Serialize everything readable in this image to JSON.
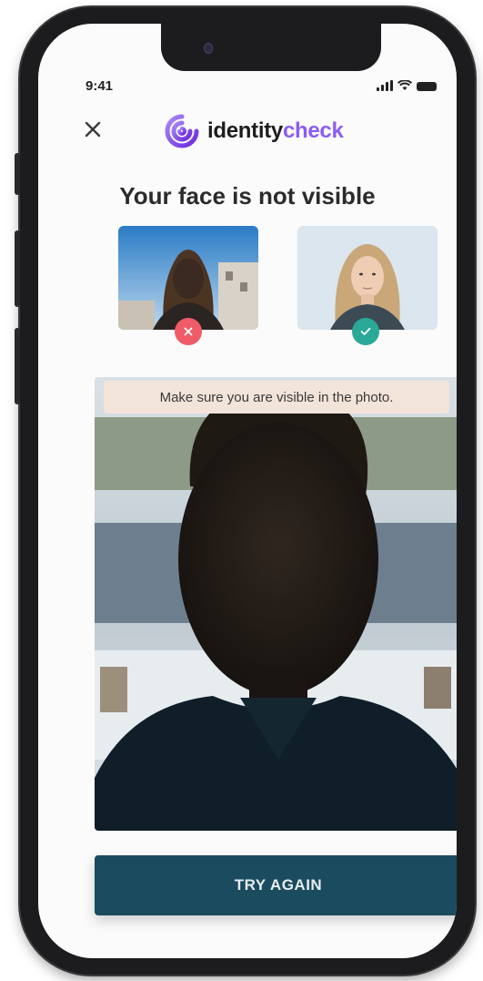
{
  "status_bar": {
    "time": "9:41"
  },
  "header": {
    "logo_part1": "identity",
    "logo_part2": "check",
    "brand_color": "#8b5cf6",
    "close_icon": "close-icon"
  },
  "headline": "Your face is not visible",
  "examples": [
    {
      "type": "bad",
      "status_icon": "x-icon",
      "color": "#ef5b66"
    },
    {
      "type": "good",
      "status_icon": "check-icon",
      "color": "#2aa898"
    }
  ],
  "hint": "Make sure you are visible in the photo.",
  "cta_label": "TRY AGAIN",
  "cta_color": "#1b4b5e"
}
